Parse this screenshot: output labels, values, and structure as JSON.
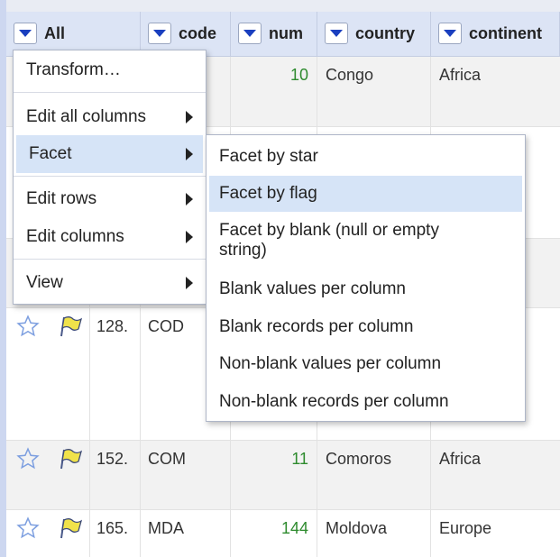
{
  "columns": [
    {
      "label": "All"
    },
    {
      "label": "code"
    },
    {
      "label": "num"
    },
    {
      "label": "country"
    },
    {
      "label": "continent"
    }
  ],
  "rows": [
    {
      "index": "",
      "code": "",
      "num": "10",
      "country": "Congo",
      "continent": "Africa"
    },
    {
      "index": "128.",
      "code": "COD",
      "num": "",
      "country": "",
      "continent": ""
    },
    {
      "index": "152.",
      "code": "COM",
      "num": "11",
      "country": "Comoros",
      "continent": "Africa"
    },
    {
      "index": "165.",
      "code": "MDA",
      "num": "144",
      "country": "Moldova",
      "continent": "Europe"
    }
  ],
  "column_menu": {
    "items": [
      {
        "label": "Transform…"
      },
      {
        "label": "Edit all columns"
      },
      {
        "label": "Facet"
      },
      {
        "label": "Edit rows"
      },
      {
        "label": "Edit columns"
      },
      {
        "label": "View"
      }
    ]
  },
  "facet_submenu": {
    "items": [
      {
        "label": "Facet by star"
      },
      {
        "label": "Facet by flag"
      },
      {
        "label": "Facet by blank (null or empty string)"
      },
      {
        "label": "Blank values per column"
      },
      {
        "label": "Blank records per column"
      },
      {
        "label": "Non-blank values per column"
      },
      {
        "label": "Non-blank records per column"
      }
    ]
  },
  "colors": {
    "accent": "#1a3fbf",
    "highlight": "#d6e4f7",
    "header": "#dce4f5",
    "number": "#2e8b2e"
  }
}
